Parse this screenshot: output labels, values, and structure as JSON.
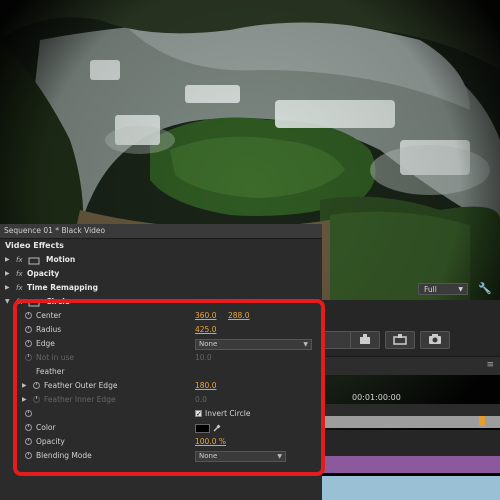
{
  "effect_controls": {
    "tab_title": "Sequence 01 * Black Video",
    "section_title": "Video Effects",
    "effects": [
      {
        "label": "Motion"
      },
      {
        "label": "Opacity"
      },
      {
        "label": "Time Remapping"
      },
      {
        "label": "Circle"
      }
    ],
    "properties": {
      "center": {
        "label": "Center",
        "x": "360.0",
        "y": "288.0"
      },
      "radius": {
        "label": "Radius",
        "value": "425.0"
      },
      "edge": {
        "label": "Edge",
        "value": "None"
      },
      "not_in_use": {
        "label": "Not in use",
        "value": "10.0"
      },
      "feather": {
        "label": "Feather"
      },
      "feather_outer": {
        "label": "Feather Outer Edge",
        "value": "180.0"
      },
      "feather_inner": {
        "label": "Feather Inner Edge",
        "value": "0.0"
      },
      "invert": {
        "label": "Invert Circle",
        "checked": true
      },
      "color": {
        "label": "Color",
        "value": "#000000"
      },
      "opacity": {
        "label": "Opacity",
        "value": "100.0 %"
      },
      "blending": {
        "label": "Blending Mode",
        "value": "None"
      }
    }
  },
  "program_monitor": {
    "resolution": "Full"
  },
  "timeline": {
    "timecode": "00:01:00:00"
  },
  "colors": {
    "value_orange": "#e9a53c",
    "highlight_red": "#e51c1c",
    "panel_bg": "#2b2b2b",
    "track_purple": "#8b5a9c",
    "track_blue": "#9ac0d6"
  },
  "icons": [
    "fx-icon",
    "motion-icon",
    "circle-effect-icon",
    "stopwatch-icon",
    "eyedropper-icon",
    "wrench-icon",
    "camera-icon",
    "insert-icon",
    "overwrite-icon"
  ]
}
